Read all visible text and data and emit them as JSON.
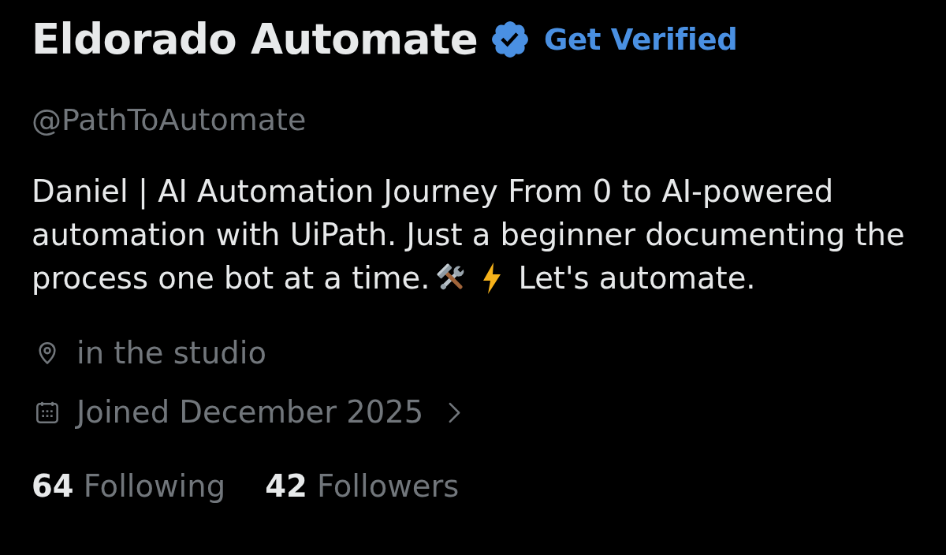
{
  "profile": {
    "display_name": "Eldorado Automate",
    "verified": true,
    "get_verified_link": "Get Verified",
    "handle": "@PathToAutomate"
  },
  "bio": {
    "text": "Daniel | AI Automation Journey From 0 to AI-powered automation with UiPath. Just a beginner documenting the process one bot at a time.",
    "closing_text": "Let's automate."
  },
  "details": [
    {
      "kind": "location",
      "text": "in the studio",
      "expandable": false
    },
    {
      "kind": "joined",
      "text": "Joined December 2025",
      "expandable": true
    }
  ],
  "stats": [
    {
      "count": "64",
      "label": "Following"
    },
    {
      "count": "42",
      "label": "Followers"
    }
  ]
}
